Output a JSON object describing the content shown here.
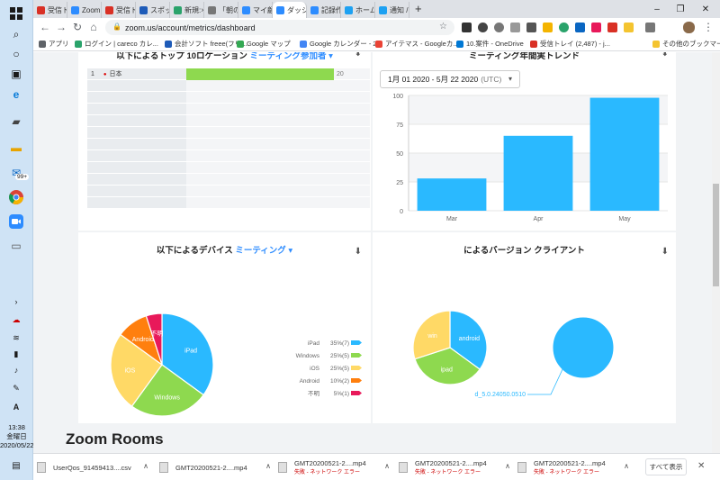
{
  "taskbar": {
    "time": "13:38",
    "day": "金曜日",
    "date": "2020/05/22",
    "mail_badge": "99+"
  },
  "tabs": [
    {
      "label": "受信ト",
      "color": "#d93025"
    },
    {
      "label": "Zoom",
      "color": "#2d8cff"
    },
    {
      "label": "受信ト",
      "color": "#d93025"
    },
    {
      "label": "スポッ",
      "color": "#1e5bb8"
    },
    {
      "label": "新規:",
      "color": "#2aa36b"
    },
    {
      "label": "「朝の",
      "color": "#777777"
    },
    {
      "label": "マイ顧",
      "color": "#2d8cff"
    },
    {
      "label": "ダッシ",
      "color": "#2d8cff"
    },
    {
      "label": "記録作",
      "color": "#2d8cff"
    },
    {
      "label": "ホーム",
      "color": "#1da1f2"
    },
    {
      "label": "通知 /",
      "color": "#1da1f2"
    }
  ],
  "address": "zoom.us/account/metrics/dashboard",
  "bookmarks": [
    {
      "label": "アプリ",
      "color": "#5f6368"
    },
    {
      "label": "ログイン | careco カレ...",
      "color": "#2aa36b"
    },
    {
      "label": "会計ソフト freee(フリ...",
      "color": "#1e5bb8"
    },
    {
      "label": "Google マップ",
      "color": "#34a853"
    },
    {
      "label": "Google カレンダー - 2...",
      "color": "#4285f4"
    },
    {
      "label": "アイテマス - Googleカ...",
      "color": "#ea4335"
    },
    {
      "label": "10.案件 - OneDrive",
      "color": "#0078d4"
    },
    {
      "label": "受信トレイ (2,487) - j...",
      "color": "#d93025"
    },
    {
      "label": "その他のブックマーク",
      "color": "#f4c430"
    }
  ],
  "cards": {
    "locations": {
      "title": "以下によるトップ 10ロケーション",
      "link": "ミーティング参加者 ▾",
      "rows": [
        {
          "rank": "1",
          "name": "日本",
          "value": 20,
          "label": "20"
        }
      ]
    },
    "trend": {
      "title": "ミーティング年間実トレンド",
      "date_range": "1月 01 2020 - 5月 22 2020",
      "timezone": "(UTC)"
    },
    "devices": {
      "title": "以下によるデバイス",
      "link": "ミーティング ▾"
    },
    "versions": {
      "title": "によるバージョン クライアント"
    }
  },
  "zoom_rooms_heading": "Zoom Rooms",
  "downloads": [
    {
      "name": "UserQos_91459413....csv",
      "status": ""
    },
    {
      "name": "GMT20200521-2....mp4",
      "status": ""
    },
    {
      "name": "GMT20200521-2....mp4",
      "status": "失敗 - ネットワーク エラー"
    },
    {
      "name": "GMT20200521-2....mp4",
      "status": "失敗 - ネットワーク エラー"
    },
    {
      "name": "GMT20200521-2....mp4",
      "status": "失敗 - ネットワーク エラー"
    }
  ],
  "show_all": "すべて表示",
  "chart_data": [
    {
      "type": "bar",
      "title": "ミーティング年間実トレンド",
      "categories": [
        "Mar",
        "Apr",
        "May"
      ],
      "values": [
        28,
        65,
        98
      ],
      "ylim": [
        0,
        100
      ],
      "yticks": [
        0,
        25,
        50,
        75,
        100
      ],
      "color": "#2ab9ff",
      "grid": true
    },
    {
      "type": "pie",
      "title": "以下によるデバイス",
      "slices": [
        {
          "label": "iPad",
          "value": 35,
          "count": 7,
          "legend": "35%(7)",
          "color": "#2ab9ff"
        },
        {
          "label": "Windows",
          "value": 25,
          "count": 5,
          "legend": "25%(5)",
          "color": "#8ed94f"
        },
        {
          "label": "iOS",
          "value": 25,
          "count": 5,
          "legend": "25%(5)",
          "color": "#ffd966"
        },
        {
          "label": "Android",
          "value": 10,
          "count": 2,
          "legend": "10%(2)",
          "color": "#ff7f0e"
        },
        {
          "label": "不明",
          "value": 5,
          "count": 1,
          "legend": "5%(1)",
          "color": "#e8195a"
        }
      ],
      "legend_position": "right"
    },
    {
      "type": "pie",
      "title": "によるバージョン クライアント",
      "slices": [
        {
          "label": "android",
          "value": 35,
          "color": "#2ab9ff"
        },
        {
          "label": "ipad",
          "value": 35,
          "color": "#8ed94f"
        },
        {
          "label": "win",
          "value": 30,
          "color": "#ffd966"
        }
      ]
    },
    {
      "type": "pie",
      "title": "によるバージョン クライアント",
      "slices": [
        {
          "label": "d_5.0.24050.0510",
          "value": 100,
          "color": "#2ab9ff"
        }
      ]
    }
  ]
}
